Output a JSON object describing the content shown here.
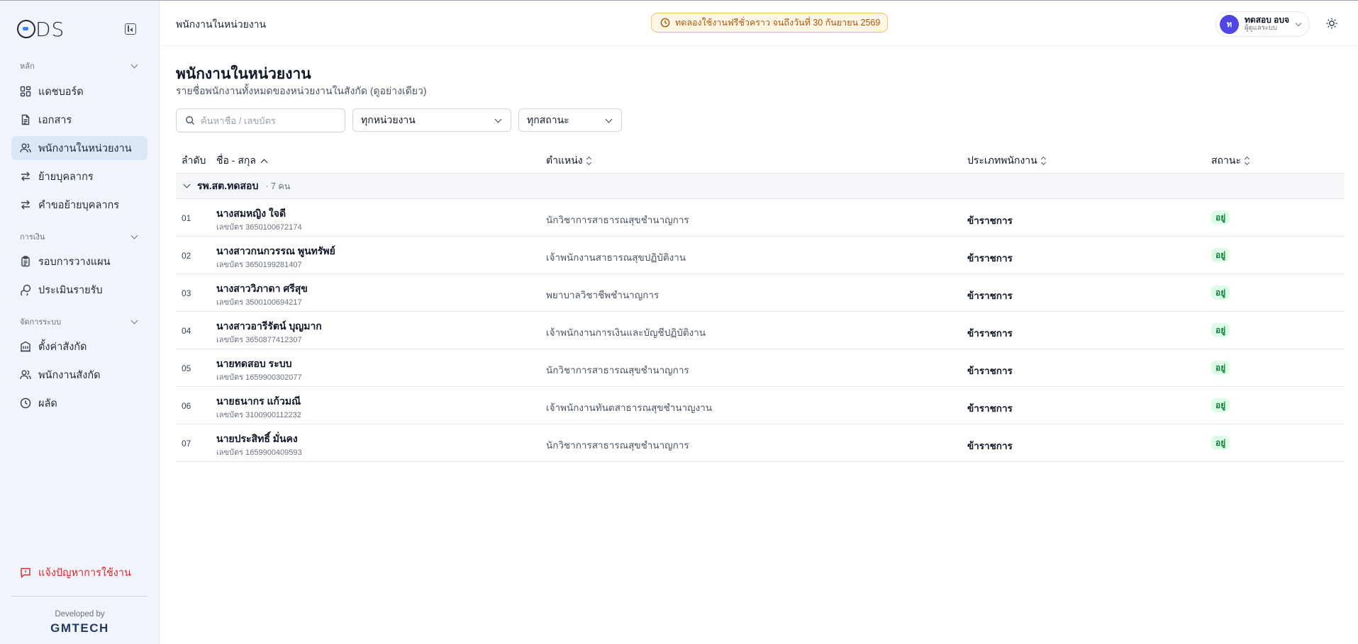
{
  "sidebar": {
    "logo_text": "ODS",
    "sections": [
      {
        "title": "หลัก",
        "items": [
          {
            "label": "แดชบอร์ด",
            "icon": "dashboard-icon"
          },
          {
            "label": "เอกสาร",
            "icon": "document-icon"
          },
          {
            "label": "พนักงานในหน่วยงาน",
            "icon": "users-icon",
            "active": true
          },
          {
            "label": "ย้ายบุคลากร",
            "icon": "transfer-icon"
          },
          {
            "label": "คำขอย้ายบุคลากร",
            "icon": "transfer-request-icon"
          }
        ]
      },
      {
        "title": "การเงิน",
        "items": [
          {
            "label": "รอบการวางแผน",
            "icon": "clipboard-icon"
          },
          {
            "label": "ประเมินรายรับ",
            "icon": "coins-icon"
          }
        ]
      },
      {
        "title": "จัดการระบบ",
        "items": [
          {
            "label": "ตั้งค่าสังกัด",
            "icon": "building-icon"
          },
          {
            "label": "พนักงานสังกัด",
            "icon": "users-icon"
          },
          {
            "label": "ผลัด",
            "icon": "clock-icon"
          }
        ]
      }
    ],
    "report_label": "แจ้งปัญหาการใช้งาน",
    "developed_by": "Developed by",
    "developer": "GMTECH"
  },
  "header": {
    "title": "พนักงานในหน่วยงาน",
    "trial_notice": "ทดลองใช้งานฟรีชั่วคราว จนถึงวันที่ 30 กันยายน 2569",
    "user": {
      "initial": "ท",
      "name": "ทดสอบ อบจ",
      "role": "ผู้ดูแลระบบ"
    }
  },
  "main": {
    "title": "พนักงานในหน่วยงาน",
    "subtitle": "รายชื่อพนักงานทั้งหมดของหน่วยงานในสังกัด (ดูอย่างเดียว)",
    "search_placeholder": "ค้นหาชื่อ / เลขบัตร",
    "unit_filter": "ทุกหน่วยงาน",
    "status_filter": "ทุกสถานะ"
  },
  "table": {
    "columns": {
      "index": "ลำดับ",
      "name": "ชื่อ - สกุล",
      "position": "ตำแหน่ง",
      "type": "ประเภทพนักงาน",
      "status": "สถานะ"
    },
    "group": {
      "name": "รพ.สต.ทดสอบ",
      "count": "· 7 คน"
    },
    "id_prefix": "เลขบัตร",
    "rows": [
      {
        "index": "01",
        "name": "นางสมหญิง ใจดี",
        "id": "เลขบัตร 3650100672174",
        "position": "นักวิชาการสาธารณสุขชำนาญการ",
        "type": "ข้าราชการ",
        "status": "อยู่"
      },
      {
        "index": "02",
        "name": "นางสาวกนกวรรณ พูนทรัพย์",
        "id": "เลขบัตร 3650199281407",
        "position": "เจ้าพนักงานสาธารณสุขปฏิบัติงาน",
        "type": "ข้าราชการ",
        "status": "อยู่"
      },
      {
        "index": "03",
        "name": "นางสาววิภาดา ศรีสุข",
        "id": "เลขบัตร 3500100694217",
        "position": "พยาบาลวิชาชีพชำนาญการ",
        "type": "ข้าราชการ",
        "status": "อยู่"
      },
      {
        "index": "04",
        "name": "นางสาวอารีรัตน์ บุญมาก",
        "id": "เลขบัตร 3650877412307",
        "position": "เจ้าพนักงานการเงินและบัญชีปฏิบัติงาน",
        "type": "ข้าราชการ",
        "status": "อยู่"
      },
      {
        "index": "05",
        "name": "นายทดสอบ ระบบ",
        "id": "เลขบัตร 1659900302077",
        "position": "นักวิชาการสาธารณสุขชำนาญการ",
        "type": "ข้าราชการ",
        "status": "อยู่"
      },
      {
        "index": "06",
        "name": "นายธนากร แก้วมณี",
        "id": "เลขบัตร 3100900112232",
        "position": "เจ้าพนักงานทันตสาธารณสุขชำนาญงาน",
        "type": "ข้าราชการ",
        "status": "อยู่"
      },
      {
        "index": "07",
        "name": "นายประสิทธิ์ มั่นคง",
        "id": "เลขบัตร 1659900409593",
        "position": "นักวิชาการสาธารณสุขชำนาญการ",
        "type": "ข้าราชการ",
        "status": "อยู่"
      }
    ]
  },
  "colors": {
    "accent": "#4f46e5",
    "active_nav": "#dbe7f7",
    "status_ok_bg": "#dcfce7",
    "status_ok_text": "#15803d",
    "trial_text": "#b45309",
    "report": "#dc2626"
  }
}
